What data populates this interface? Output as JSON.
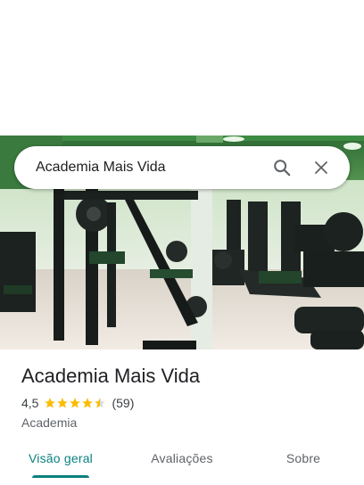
{
  "search": {
    "value": "Academia Mais Vida"
  },
  "place": {
    "name": "Academia Mais Vida",
    "rating": "4,5",
    "stars": 4.5,
    "reviews_count": "(59)",
    "category": "Academia"
  },
  "tabs": [
    {
      "label": "Visão geral",
      "active": true
    },
    {
      "label": "Avaliações",
      "active": false
    },
    {
      "label": "Sobre",
      "active": false
    }
  ],
  "colors": {
    "accent": "#0b8080",
    "star": "#fbbc04"
  }
}
